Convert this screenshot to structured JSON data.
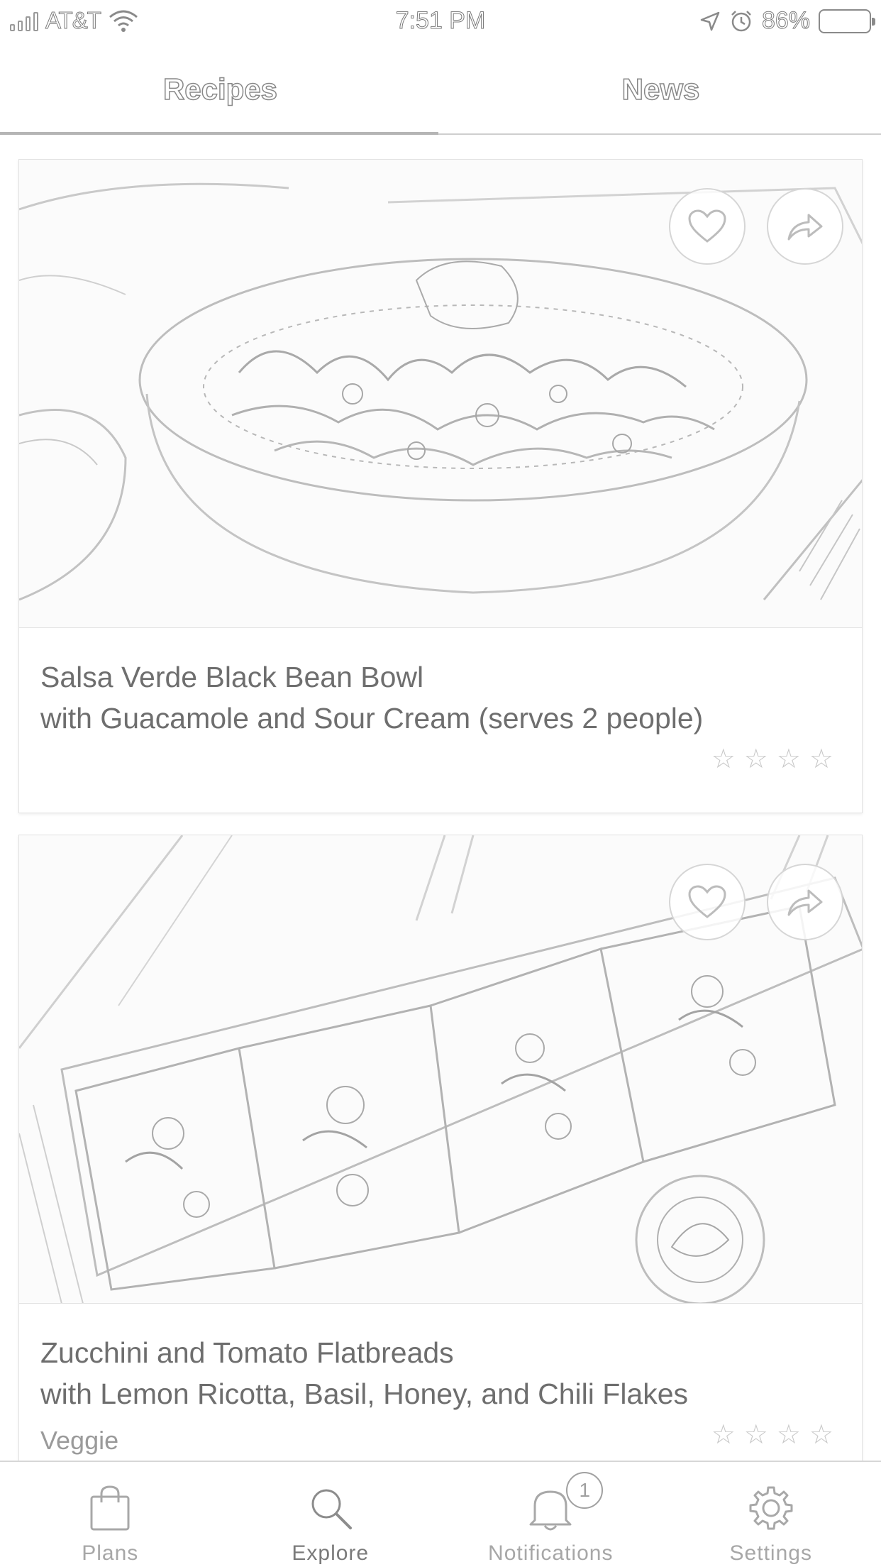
{
  "status_bar": {
    "carrier": "AT&T",
    "time": "7:51 PM",
    "battery": "86%"
  },
  "top_tabs": [
    {
      "label": "Recipes",
      "active": true
    },
    {
      "label": "News",
      "active": false
    }
  ],
  "recipes": [
    {
      "title": "Salsa Verde Black Bean Bowl",
      "subtitle": "with Guacamole and Sour Cream (serves 2 people)",
      "tag": "",
      "rating_stars": 4
    },
    {
      "title": "Zucchini and Tomato Flatbreads",
      "subtitle": "with Lemon Ricotta, Basil, Honey, and Chili Flakes",
      "tag": "Veggie",
      "rating_stars": 4
    }
  ],
  "bottom_nav": {
    "items": [
      {
        "label": "Plans",
        "icon": "shopping-bag-icon"
      },
      {
        "label": "Explore",
        "icon": "search-icon",
        "active": true
      },
      {
        "label": "Notifications",
        "icon": "bell-icon",
        "badge": "1"
      },
      {
        "label": "Settings",
        "icon": "gear-icon"
      }
    ]
  }
}
